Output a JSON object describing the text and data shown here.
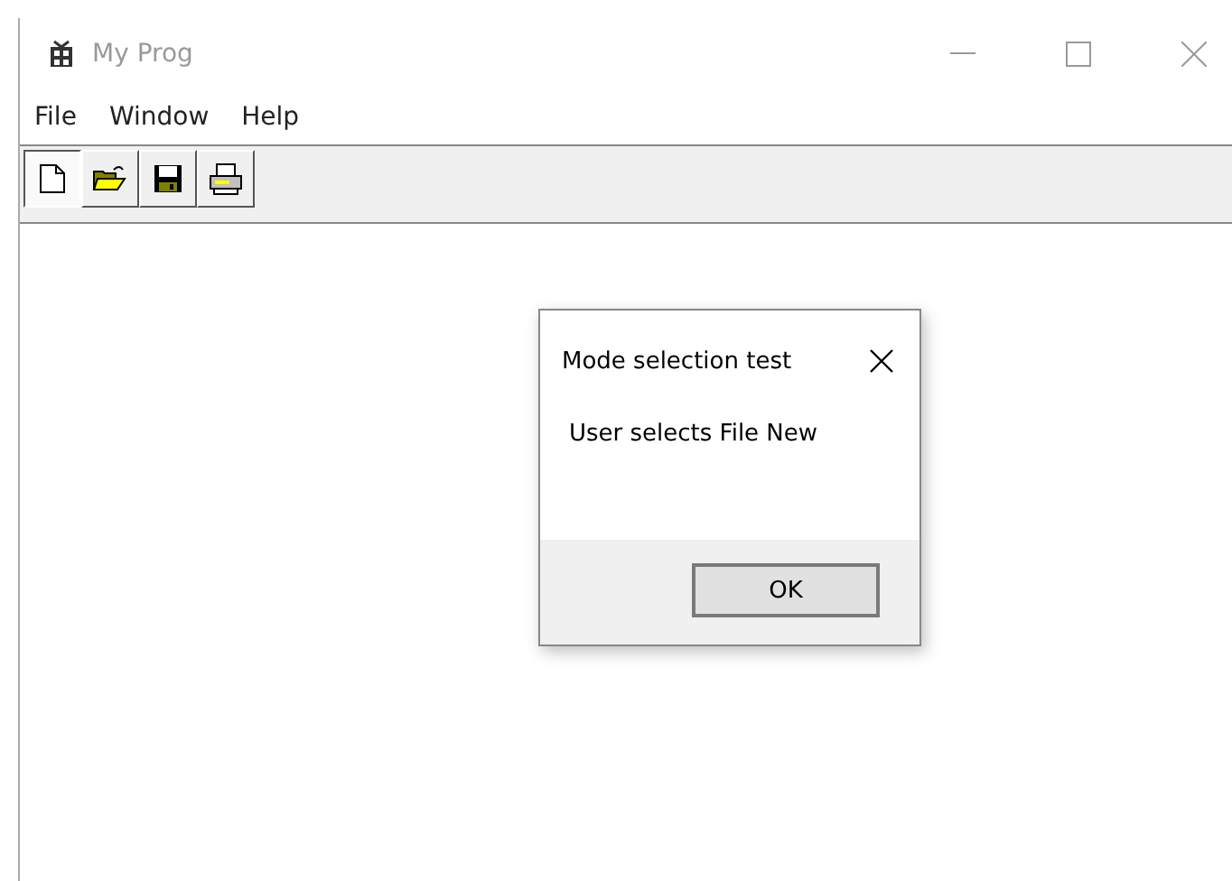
{
  "window": {
    "title": "My Prog",
    "active": false
  },
  "menu": [
    "File",
    "Window",
    "Help"
  ],
  "toolbar": [
    {
      "kind": "new",
      "selected": true
    },
    {
      "kind": "open",
      "selected": false
    },
    {
      "kind": "save",
      "selected": false
    },
    {
      "kind": "print",
      "selected": false
    }
  ],
  "dialog": {
    "title": "Mode selection test",
    "message": "User selects File New",
    "buttons": [
      "OK"
    ]
  }
}
